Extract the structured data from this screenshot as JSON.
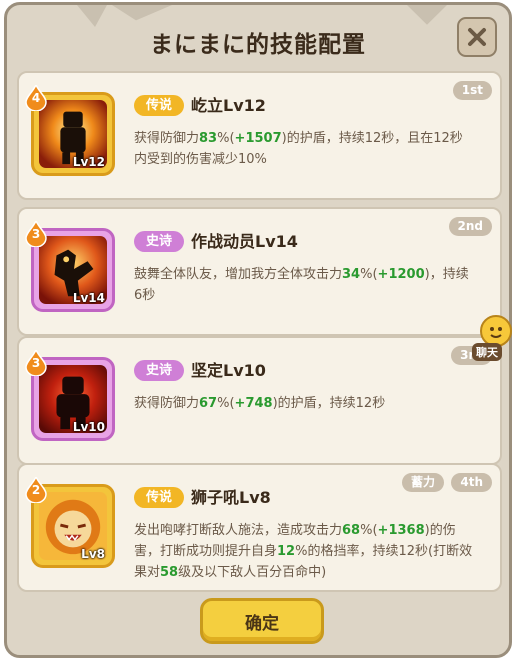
{
  "dialog": {
    "title": "まにまに的技能配置",
    "confirm_label": "确定"
  },
  "chat": {
    "label": "聊天"
  },
  "skills": [
    {
      "rank": "4",
      "order": "1st",
      "rarity": "传说",
      "name": "屹立Lv12",
      "level": "Lv12",
      "desc": [
        {
          "t": "获得防御力",
          "c": "n"
        },
        {
          "t": "83",
          "c": "g"
        },
        {
          "t": "%(",
          "c": "n"
        },
        {
          "t": "+1507",
          "c": "g"
        },
        {
          "t": ")的护盾，持续12秒，且在12秒内受到的伤害减少10%",
          "c": "n"
        }
      ]
    },
    {
      "rank": "3",
      "order": "2nd",
      "rarity": "史诗",
      "name": "作战动员Lv14",
      "level": "Lv14",
      "desc": [
        {
          "t": "鼓舞全体队友，增加我方全体攻击力",
          "c": "n"
        },
        {
          "t": "34",
          "c": "g"
        },
        {
          "t": "%(",
          "c": "n"
        },
        {
          "t": "+1200",
          "c": "g"
        },
        {
          "t": ")，持续6秒",
          "c": "n"
        }
      ]
    },
    {
      "rank": "3",
      "order": "3rd",
      "rarity": "史诗",
      "name": "坚定Lv10",
      "level": "Lv10",
      "desc": [
        {
          "t": "获得防御力",
          "c": "n"
        },
        {
          "t": "67",
          "c": "g"
        },
        {
          "t": "%(",
          "c": "n"
        },
        {
          "t": "+748",
          "c": "g"
        },
        {
          "t": ")的护盾，持续12秒",
          "c": "n"
        }
      ]
    },
    {
      "rank": "2",
      "order": "4th",
      "tag": "蓄力",
      "rarity": "传说",
      "name": "狮子吼Lv8",
      "level": "Lv8",
      "desc": [
        {
          "t": "发出咆哮打断敌人施法，造成攻击力",
          "c": "n"
        },
        {
          "t": "68",
          "c": "g"
        },
        {
          "t": "%(",
          "c": "n"
        },
        {
          "t": "+1368",
          "c": "g"
        },
        {
          "t": ")的伤害，打断成功则提升自身",
          "c": "n"
        },
        {
          "t": "12",
          "c": "g"
        },
        {
          "t": "%的格挡率，持续12秒(打断效果对",
          "c": "n"
        },
        {
          "t": "58",
          "c": "g"
        },
        {
          "t": "级及以下敌人百分百命中)",
          "c": "n"
        }
      ]
    }
  ],
  "colors": {
    "legend": "#f2b625",
    "epic": "#cf7fd6",
    "highlight": "#2a9a2f",
    "panel": "#ddd5c6",
    "card": "#f7f2e7"
  },
  "icons": [
    "close-icon",
    "defense-stand-icon",
    "battle-rally-icon",
    "firm-stance-icon",
    "lion-roar-icon",
    "chat-emoji-icon"
  ]
}
